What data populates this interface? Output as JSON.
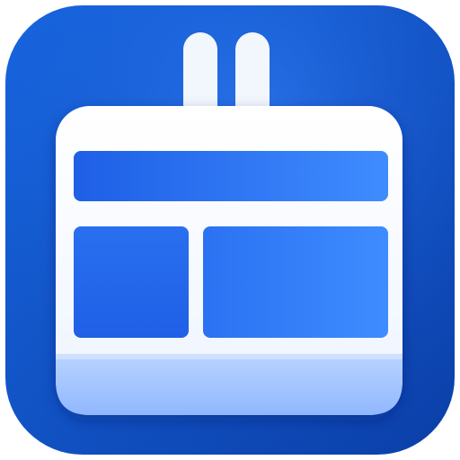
{
  "icon": {
    "name": "calendar-layout-icon",
    "colors": {
      "background_top_left": "#1766e0",
      "background_bottom_right": "#0b3fa8",
      "body_white": "#f6f9ff",
      "body_shadow": "#d9e6fb",
      "panel_blue_light": "#3f8cff",
      "panel_blue_dark": "#1e5fe6",
      "footer_band_top": "#b9d3ff",
      "footer_band_bottom": "#90b8ff",
      "hook_white": "#f2f6fd"
    }
  }
}
